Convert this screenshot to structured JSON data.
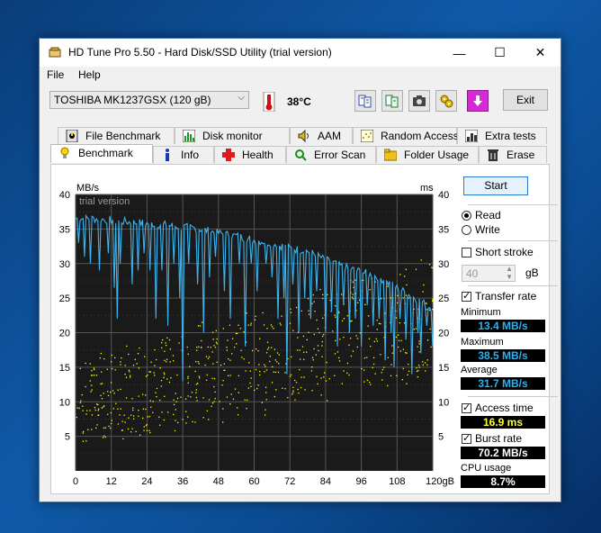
{
  "window": {
    "title": "HD Tune Pro 5.50 - Hard Disk/SSD Utility (trial version)",
    "controls": {
      "minimize": "—",
      "maximize": "☐",
      "close": "✕"
    }
  },
  "menu": [
    "File",
    "Help"
  ],
  "toolbar": {
    "drive": "TOSHIBA MK1237GSX (120 gB)",
    "temperature": "38°C",
    "exit_label": "Exit"
  },
  "tabs_top": [
    "File Benchmark",
    "Disk monitor",
    "AAM",
    "Random Access",
    "Extra tests"
  ],
  "tabs_bottom": [
    "Benchmark",
    "Info",
    "Health",
    "Error Scan",
    "Folder Usage",
    "Erase"
  ],
  "active_tab": "Benchmark",
  "controls": {
    "start_label": "Start",
    "read_label": "Read",
    "write_label": "Write",
    "mode": "Read",
    "short_stroke_label": "Short stroke",
    "short_stroke_checked": false,
    "stroke_value": "40",
    "stroke_unit": "gB",
    "transfer_rate_label": "Transfer rate",
    "transfer_rate_checked": true,
    "access_time_label": "Access time",
    "access_time_checked": true,
    "burst_rate_label": "Burst rate",
    "burst_rate_checked": true
  },
  "results": {
    "minimum_label": "Minimum",
    "minimum": "13.4 MB/s",
    "maximum_label": "Maximum",
    "maximum": "38.5 MB/s",
    "average_label": "Average",
    "average": "31.7 MB/s",
    "access_time": "16.9 ms",
    "burst_rate": "70.2 MB/s",
    "cpu_usage_label": "CPU usage",
    "cpu_usage": "8.7%"
  },
  "chart_data": {
    "type": "line",
    "watermark": "trial version",
    "y_left_unit": "MB/s",
    "y_right_unit": "ms",
    "x_unit": "gB",
    "ylim": [
      0,
      40
    ],
    "xlim": [
      0,
      120
    ],
    "y_ticks_left": [
      5,
      10,
      15,
      20,
      25,
      30,
      35,
      40
    ],
    "y_ticks_right": [
      5,
      10,
      15,
      20,
      25,
      30,
      35,
      40
    ],
    "x_ticks": [
      "0",
      "12",
      "24",
      "36",
      "48",
      "60",
      "72",
      "84",
      "96",
      "108",
      "120gB"
    ],
    "grid": true,
    "colors": {
      "transfer": "#3cb4ef",
      "access": "#ffff00",
      "background": "#1a1a1a",
      "grid": "#555555"
    },
    "transfer_rate_series": {
      "name": "Transfer rate",
      "baseline": [
        [
          0,
          36.5
        ],
        [
          6,
          36.5
        ],
        [
          12,
          36.3
        ],
        [
          18,
          36
        ],
        [
          24,
          35.8
        ],
        [
          30,
          35.6
        ],
        [
          36,
          35.3
        ],
        [
          42,
          35
        ],
        [
          48,
          34.4
        ],
        [
          54,
          34
        ],
        [
          60,
          33.4
        ],
        [
          66,
          33
        ],
        [
          72,
          32.2
        ],
        [
          78,
          31.8
        ],
        [
          84,
          30.5
        ],
        [
          90,
          29.5
        ],
        [
          96,
          28.8
        ],
        [
          102,
          28
        ],
        [
          108,
          26.5
        ],
        [
          114,
          25
        ],
        [
          120,
          23.5
        ]
      ],
      "dips": [
        [
          1,
          33
        ],
        [
          3,
          31
        ],
        [
          5,
          30
        ],
        [
          8,
          29
        ],
        [
          11,
          31.5
        ],
        [
          13,
          26.5
        ],
        [
          14,
          22
        ],
        [
          15,
          30
        ],
        [
          19,
          27
        ],
        [
          21,
          29
        ],
        [
          23,
          31.5
        ],
        [
          25,
          29
        ],
        [
          27,
          22
        ],
        [
          29,
          29
        ],
        [
          31,
          21
        ],
        [
          33,
          30
        ],
        [
          35,
          25
        ],
        [
          36,
          13
        ],
        [
          38,
          30
        ],
        [
          41,
          27
        ],
        [
          43,
          20
        ],
        [
          45,
          28
        ],
        [
          47,
          31
        ],
        [
          50,
          26
        ],
        [
          52,
          22
        ],
        [
          55,
          30
        ],
        [
          57,
          18
        ],
        [
          59,
          30
        ],
        [
          61,
          26
        ],
        [
          64,
          30
        ],
        [
          66,
          28
        ],
        [
          68,
          22
        ],
        [
          70,
          25
        ],
        [
          71,
          14
        ],
        [
          73,
          27
        ],
        [
          75,
          20
        ],
        [
          77,
          25
        ],
        [
          79,
          22
        ],
        [
          81,
          26
        ],
        [
          84,
          20
        ],
        [
          86,
          23
        ],
        [
          88,
          18
        ],
        [
          90,
          24
        ],
        [
          92,
          20
        ],
        [
          94,
          22
        ],
        [
          96,
          18
        ],
        [
          98,
          24
        ],
        [
          100,
          21
        ],
        [
          102,
          22
        ],
        [
          104,
          16
        ],
        [
          106,
          20
        ],
        [
          107,
          15
        ],
        [
          109,
          22
        ],
        [
          111,
          19
        ],
        [
          113,
          14
        ],
        [
          115,
          20
        ],
        [
          116,
          17
        ],
        [
          118,
          21
        ],
        [
          120,
          18
        ]
      ]
    },
    "access_time_series": {
      "name": "Access time",
      "seed": 20,
      "center_ms": 16.9
    }
  }
}
